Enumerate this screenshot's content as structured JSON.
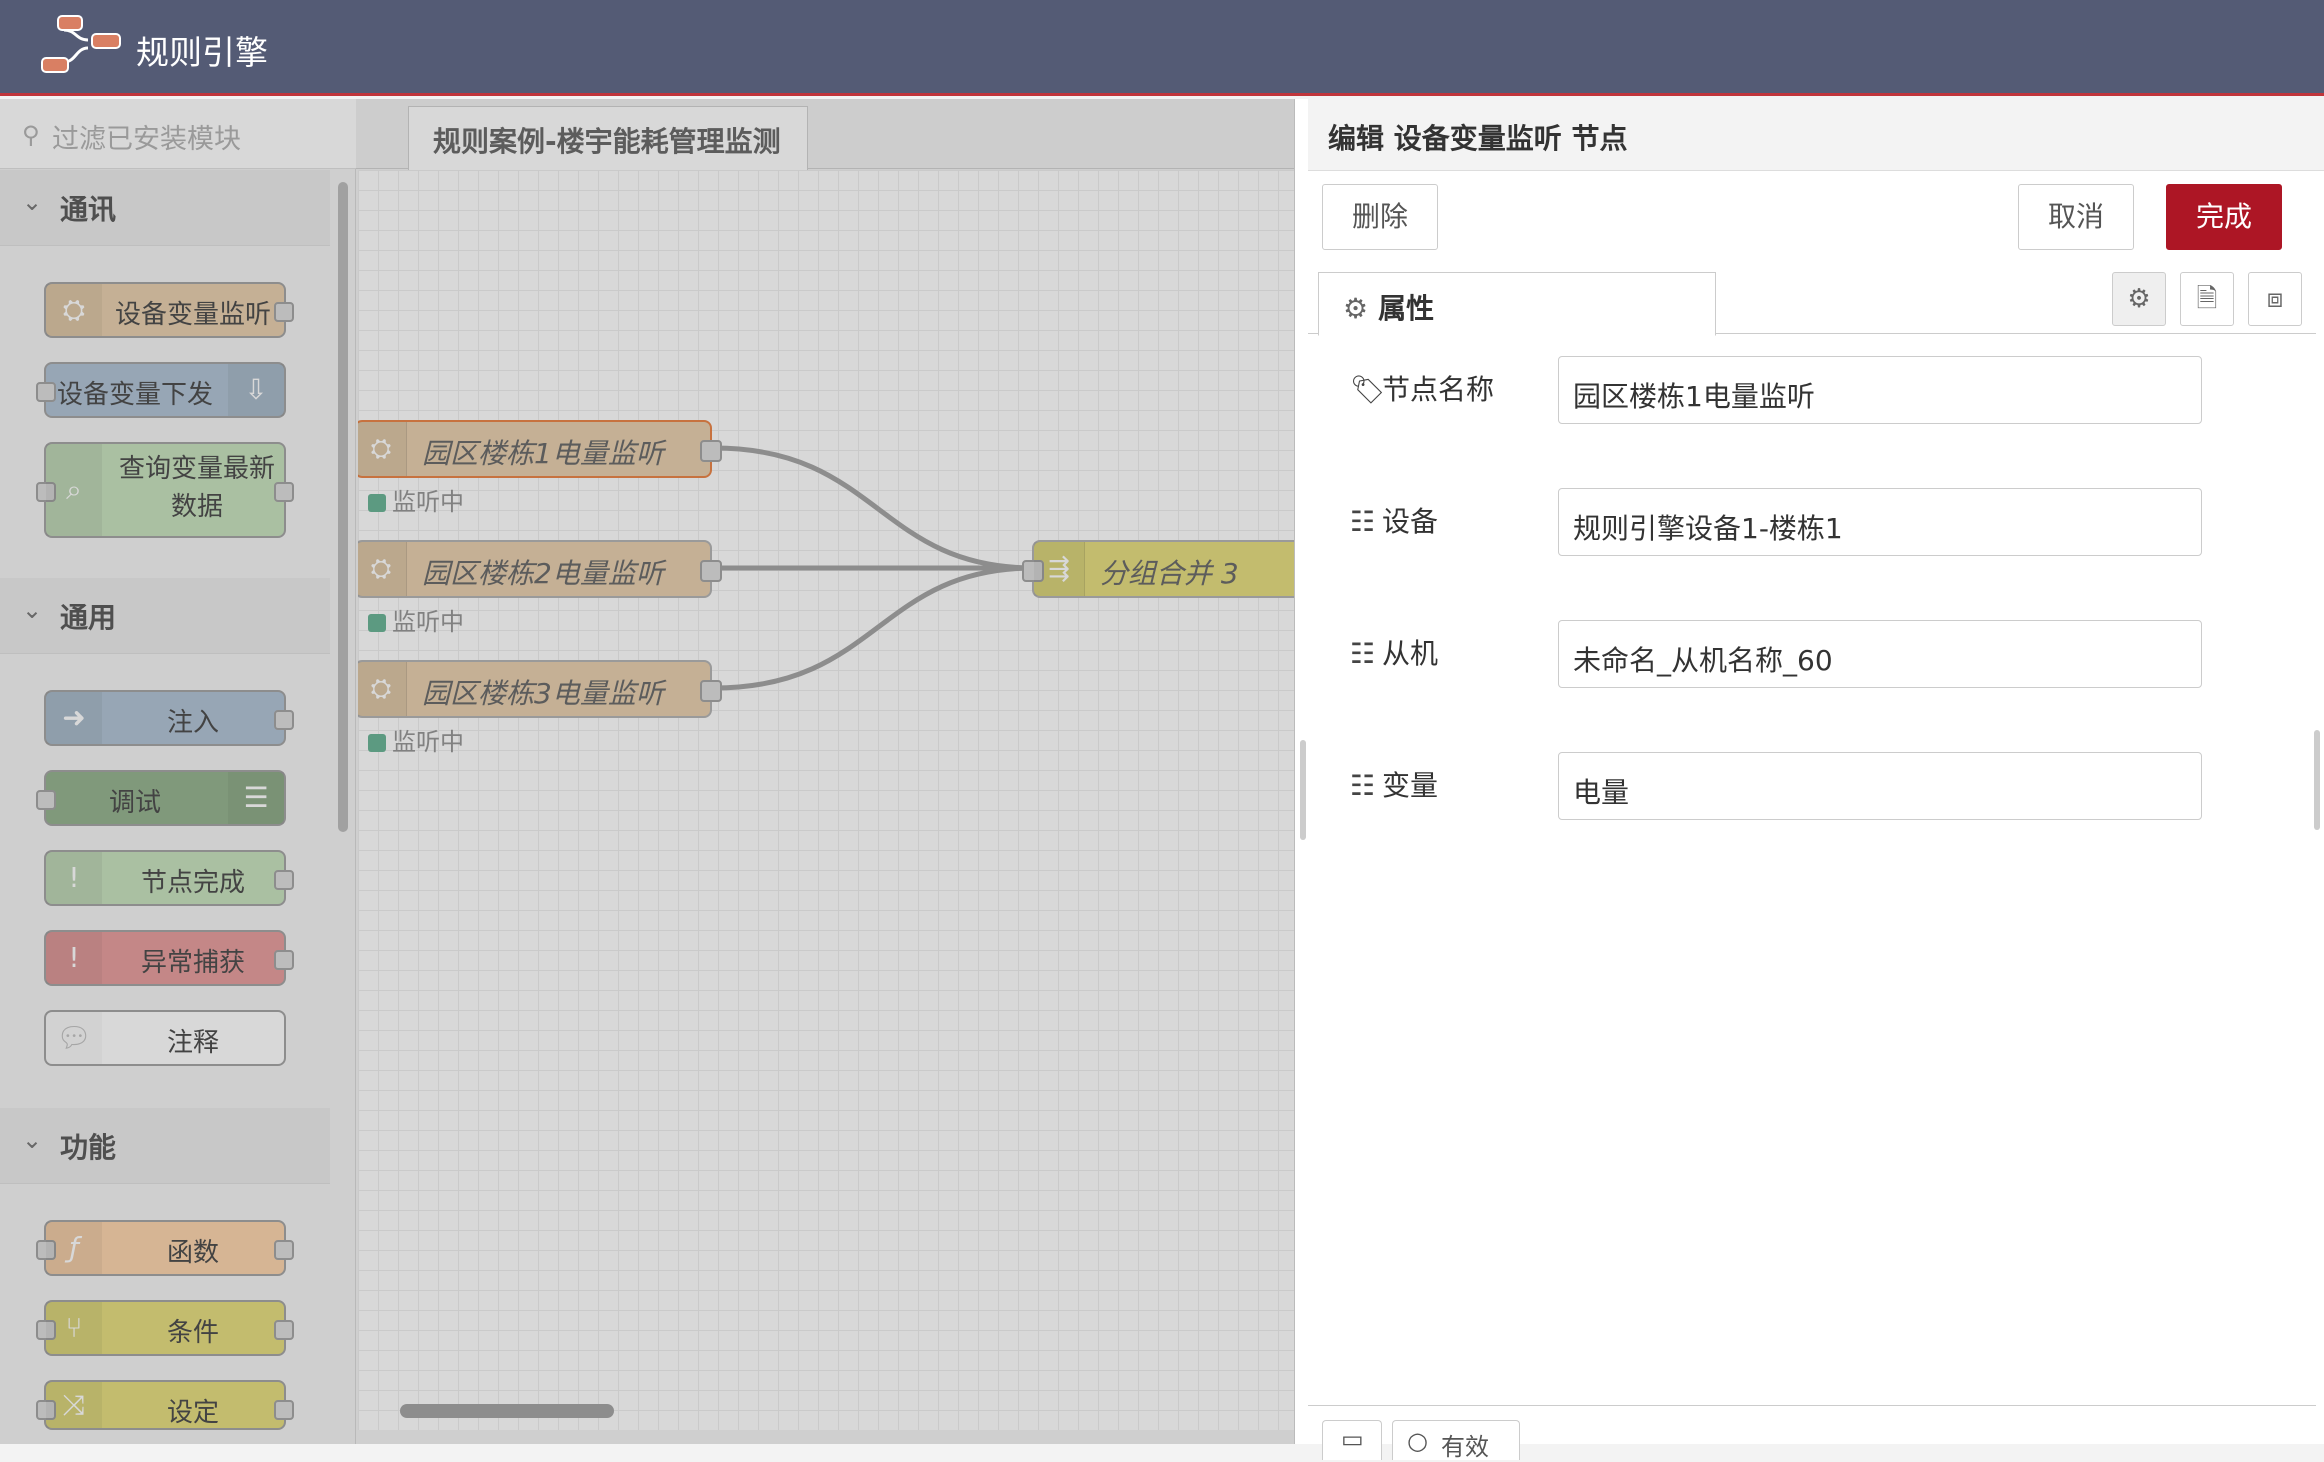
{
  "header": {
    "title": "规则引擎"
  },
  "palette": {
    "filter_placeholder": "过滤已安装模块",
    "categories": [
      {
        "label": "通讯",
        "nodes": [
          "设备变量监听",
          "设备变量下发",
          "查询变量最新数据"
        ]
      },
      {
        "label": "通用",
        "nodes": [
          "注入",
          "调试",
          "节点完成",
          "异常捕获",
          "注释"
        ]
      },
      {
        "label": "功能",
        "nodes": [
          "函数",
          "条件",
          "设定"
        ]
      }
    ]
  },
  "workspace": {
    "tab": "规则案例-楼宇能耗管理监测",
    "flow_nodes": [
      "园区楼栋1电量监听",
      "园区楼栋2电量监听",
      "园区楼栋3电量监听",
      "分组合并 3"
    ],
    "status_text": "监听中"
  },
  "editor": {
    "title": "编辑 设备变量监听 节点",
    "delete_label": "删除",
    "cancel_label": "取消",
    "done_label": "完成",
    "tab_label": "属性",
    "fields": [
      {
        "label": "节点名称",
        "icon": "tag-icon",
        "value": "园区楼栋1电量监听"
      },
      {
        "label": "设备",
        "icon": "list-icon",
        "value": "规则引擎设备1-楼栋1"
      },
      {
        "label": "从机",
        "icon": "list-icon",
        "value": "未命名_从机名称_60"
      },
      {
        "label": "变量",
        "icon": "list-icon",
        "value": "电量"
      }
    ],
    "footer_enable": "有效"
  },
  "colors": {
    "header_bg": "#545b75",
    "accent_red": "#ad1625",
    "node_orange": "#e5c9a3",
    "node_blue": "#a6bbcf",
    "node_green_debug": "#87a980",
    "node_green": "#c0deb5",
    "node_red": "#e49191",
    "node_func": "#fdd0a2",
    "node_switch": "#e2d96e"
  }
}
